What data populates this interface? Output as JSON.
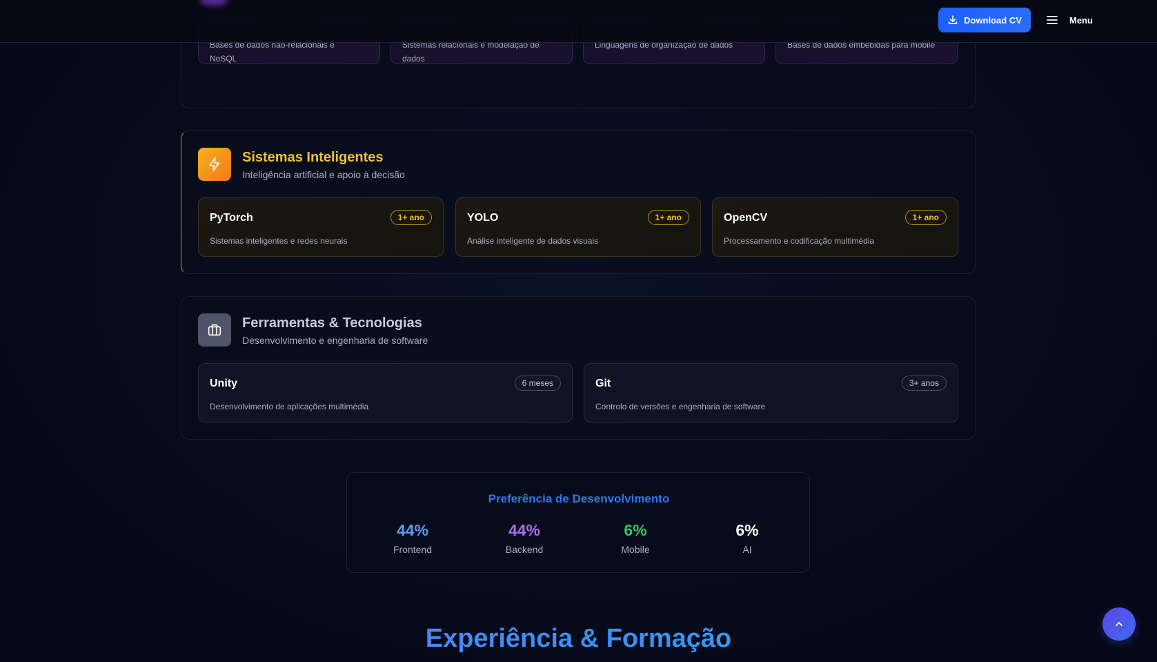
{
  "header": {
    "download_label": "Download CV",
    "menu_label": "Menu"
  },
  "databases": {
    "cards": [
      {
        "desc": "Bases de dados não-relacionais e NoSQL"
      },
      {
        "desc": "Sistemas relacionais e modelação de dados"
      },
      {
        "desc": "Linguagens de organização de dados"
      },
      {
        "desc": "Bases de dados embebidas para mobile"
      }
    ]
  },
  "intelligent": {
    "title": "Sistemas Inteligentes",
    "subtitle": "Inteligência artificial e apoio à decisão",
    "cards": [
      {
        "name": "PyTorch",
        "badge": "1+ ano",
        "desc": "Sistemas inteligentes e redes neurais"
      },
      {
        "name": "YOLO",
        "badge": "1+ ano",
        "desc": "Análise inteligente de dados visuais"
      },
      {
        "name": "OpenCV",
        "badge": "1+ ano",
        "desc": "Processamento e codificação multimédia"
      }
    ]
  },
  "tools": {
    "title": "Ferramentas & Tecnologias",
    "subtitle": "Desenvolvimento e engenharia de software",
    "cards": [
      {
        "name": "Unity",
        "badge": "6 meses",
        "desc": "Desenvolvimento de aplicações multimédia"
      },
      {
        "name": "Git",
        "badge": "3+ anos",
        "desc": "Controlo de versões e engenharia de software"
      }
    ]
  },
  "preference": {
    "title": "Preferência de Desenvolvimento",
    "stats": [
      {
        "value": "44%",
        "label": "Frontend",
        "color": "#5b9cf3"
      },
      {
        "value": "44%",
        "label": "Backend",
        "color": "#b06cf0"
      },
      {
        "value": "6%",
        "label": "Mobile",
        "color": "#35c46a"
      },
      {
        "value": "6%",
        "label": "AI",
        "color": "#ffffff"
      }
    ]
  },
  "experience": {
    "title": "Experiência & Formação"
  },
  "colors": {
    "accent_blue": "#1f5fff",
    "accent_gold": "#f2c230",
    "background": "#070b1a"
  }
}
